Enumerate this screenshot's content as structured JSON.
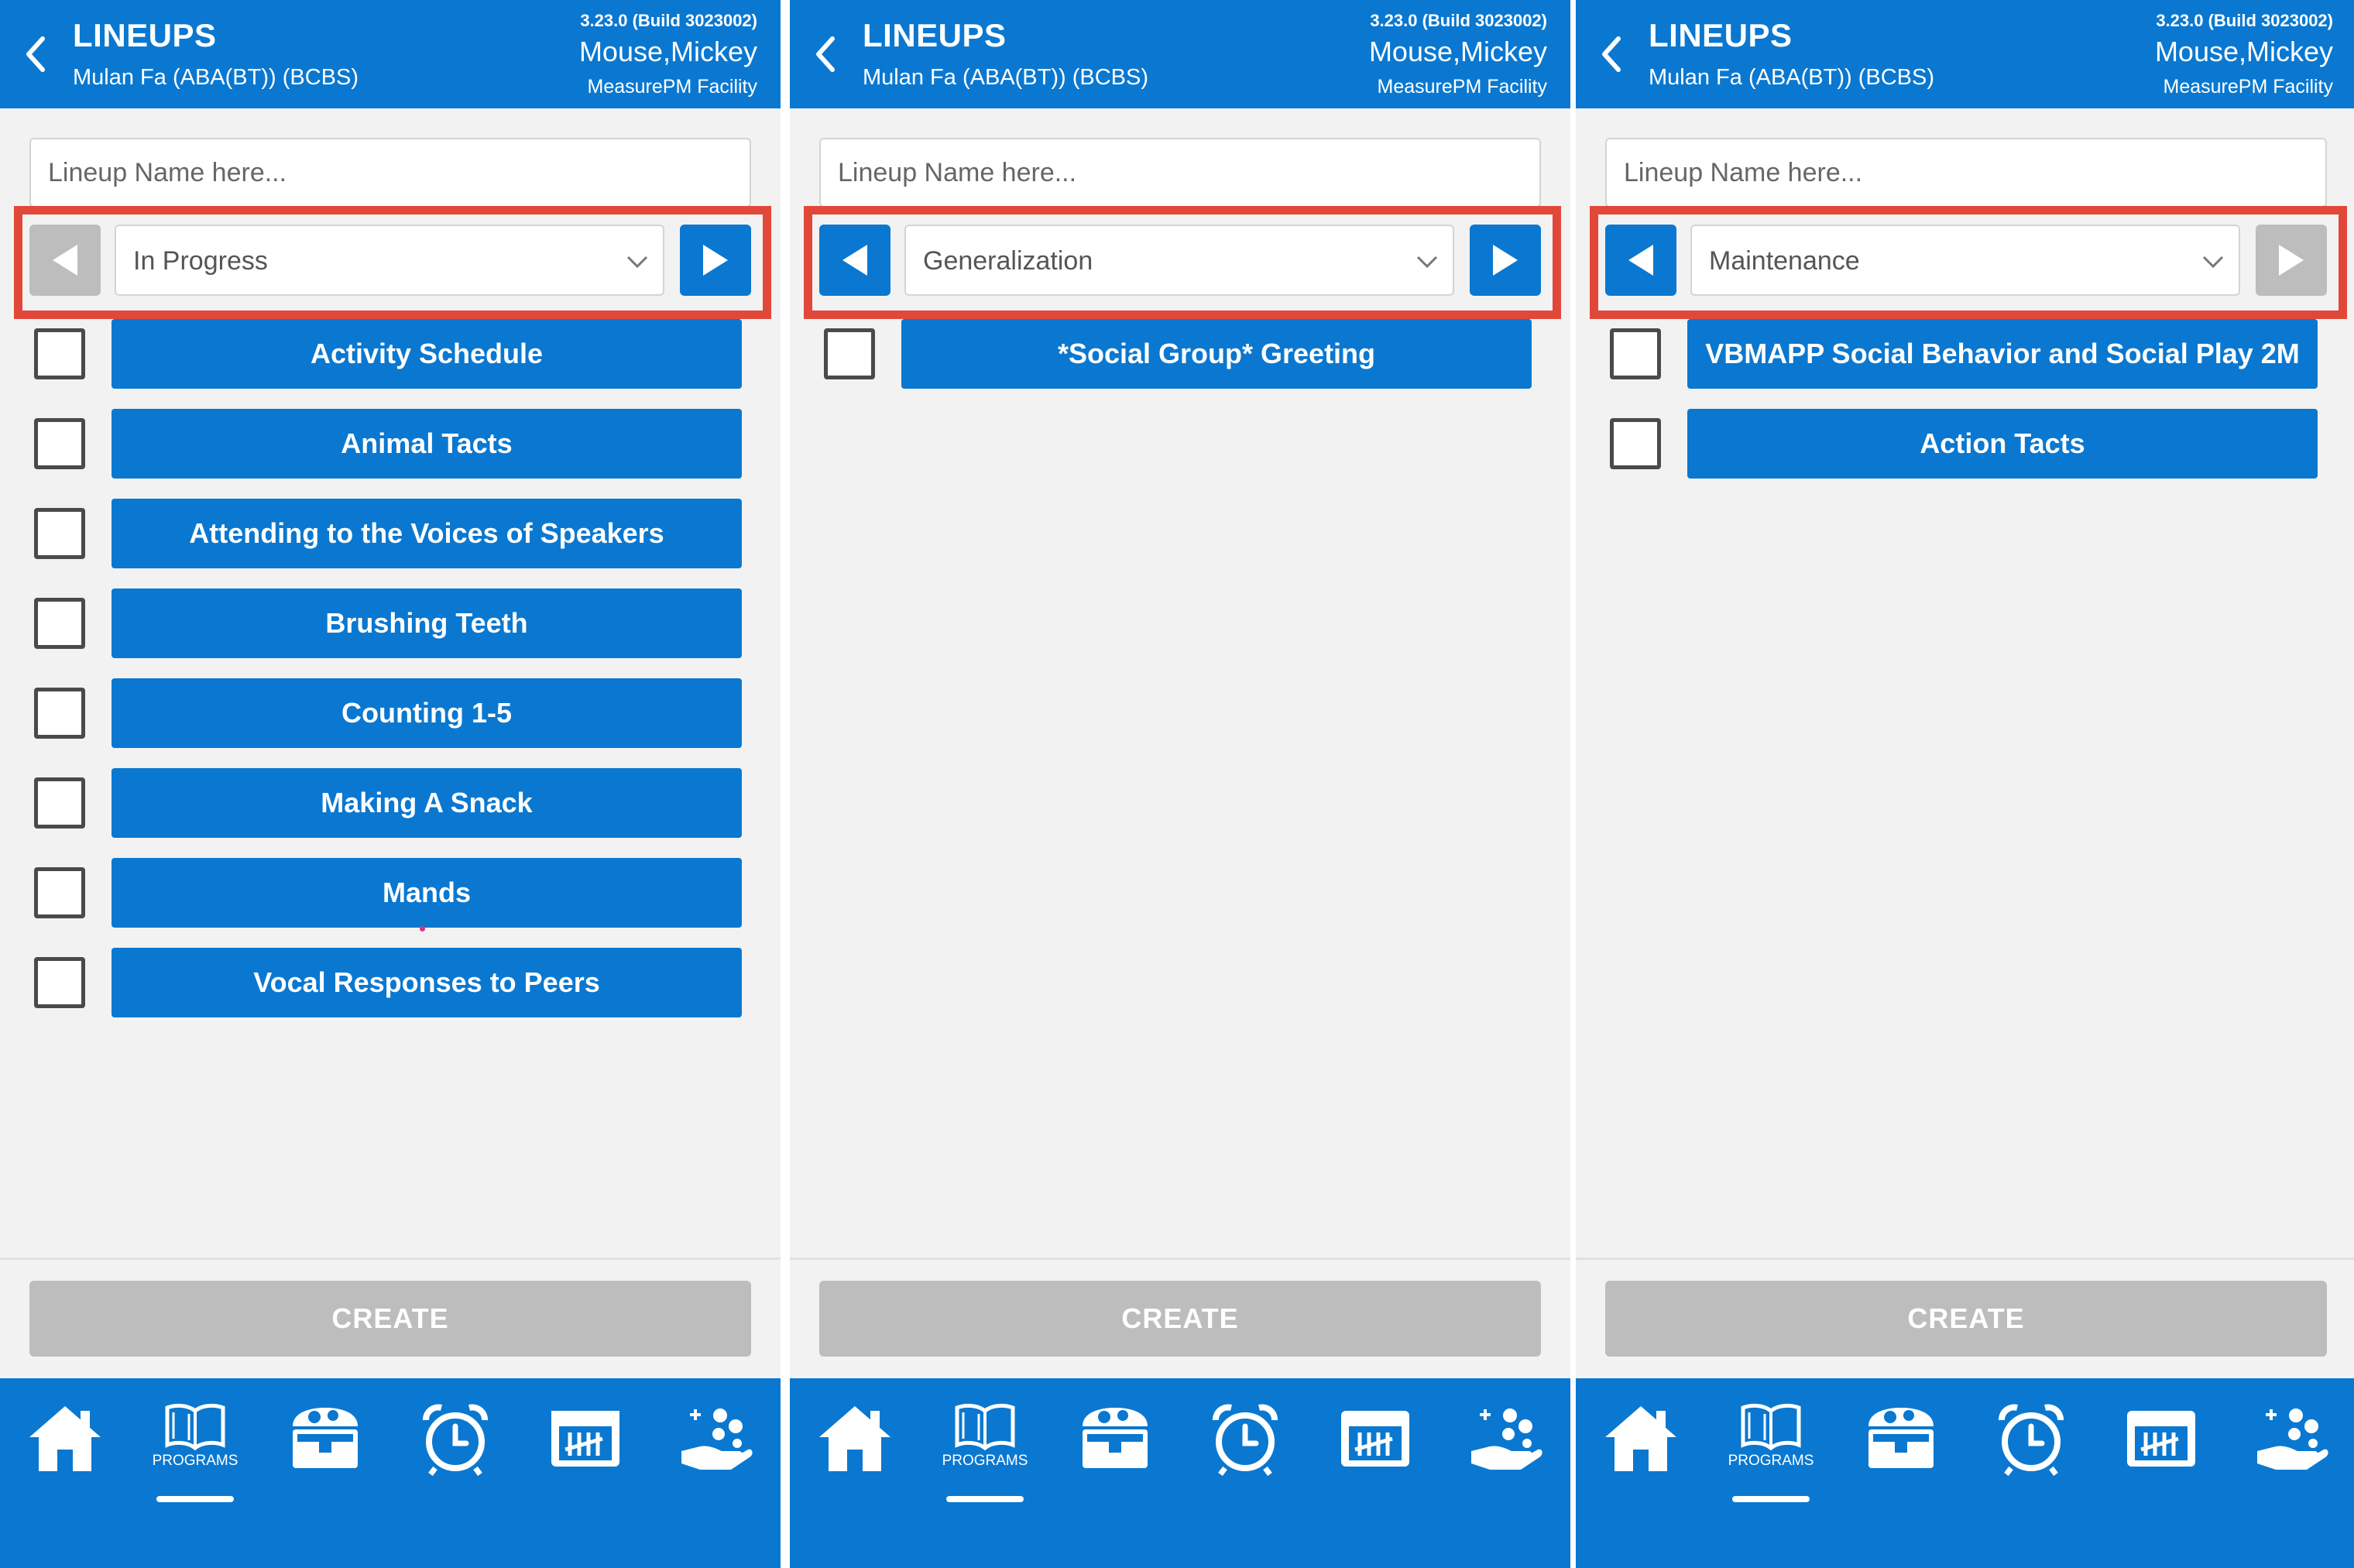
{
  "app": {
    "title": "LINEUPS",
    "subtitle": "Mulan Fa (ABA(BT)) (BCBS)",
    "version": "3.23.0 (Build 3023002)",
    "user": "Mouse,Mickey",
    "facility": "MeasurePM Facility",
    "input_placeholder": "Lineup Name here...",
    "create_label": "CREATE",
    "tabs": {
      "programs_label": "PROGRAMS"
    }
  },
  "screens": [
    {
      "status": "In Progress",
      "prev_enabled": false,
      "next_enabled": true,
      "programs": [
        "Activity Schedule",
        "Animal Tacts",
        "Attending to the Voices of Speakers",
        "Brushing Teeth",
        "Counting 1-5",
        "Making A Snack",
        "Mands",
        "Vocal Responses to Peers"
      ]
    },
    {
      "status": "Generalization",
      "prev_enabled": true,
      "next_enabled": true,
      "programs": [
        "*Social Group* Greeting"
      ]
    },
    {
      "status": "Maintenance",
      "prev_enabled": true,
      "next_enabled": false,
      "programs": [
        "VBMAPP Social Behavior and Social Play 2M",
        "Action Tacts"
      ]
    }
  ],
  "colors": {
    "primary": "#0a78d0",
    "disabled": "#bdbdbd",
    "highlight": "#e2483a",
    "background": "#f2f2f2"
  },
  "icons": [
    "chevron-left-icon",
    "triangle-left-icon",
    "triangle-right-icon",
    "chevron-down-icon",
    "home-icon",
    "book-icon",
    "treasure-chest-icon",
    "alarm-clock-icon",
    "tally-calendar-icon",
    "hand-coins-icon"
  ]
}
